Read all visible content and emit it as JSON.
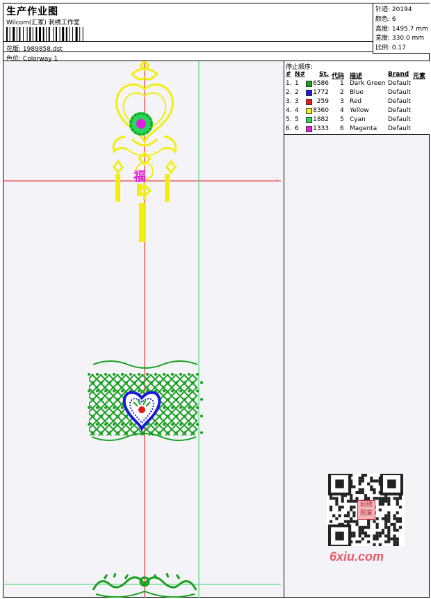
{
  "header": {
    "title": "生产作业图",
    "studio": "Wilcom(汇冢) 刺绣工作室",
    "design_label": "花版:",
    "design_file": "1989858.dst",
    "colorway_label": "色位:",
    "colorway_name": "Colorway 1"
  },
  "stats": [
    {
      "label": "针迹:",
      "value": "20194"
    },
    {
      "label": "颜色:",
      "value": "6"
    },
    {
      "label": "高度:",
      "value": "1495.7 mm"
    },
    {
      "label": "宽度:",
      "value": "330.0 mm"
    },
    {
      "label": "比例:",
      "value": "0.17"
    }
  ],
  "stop_sequence": {
    "title": "停止顺序:",
    "columns": {
      "index": "#",
      "n": "N#",
      "st": "St.",
      "code": "代码",
      "desc": "描述",
      "brand": "Brand",
      "element": "元素"
    },
    "rows": [
      {
        "index": "1.",
        "n": "1",
        "color": "#16a01e",
        "st": "6586",
        "code": "1",
        "desc": "Dark Green",
        "brand": "Default"
      },
      {
        "index": "2.",
        "n": "2",
        "color": "#1a1ad6",
        "st": "1772",
        "code": "2",
        "desc": "Blue",
        "brand": "Default"
      },
      {
        "index": "3.",
        "n": "3",
        "color": "#e41b1b",
        "st": "259",
        "code": "3",
        "desc": "Red",
        "brand": "Default"
      },
      {
        "index": "4.",
        "n": "4",
        "color": "#f2ee10",
        "st": "8360",
        "code": "4",
        "desc": "Yellow",
        "brand": "Default"
      },
      {
        "index": "5.",
        "n": "5",
        "color": "#2ad65a",
        "st": "1882",
        "code": "5",
        "desc": "Cyan",
        "brand": "Default"
      },
      {
        "index": "6.",
        "n": "6",
        "color": "#e21ee2",
        "st": "1333",
        "code": "6",
        "desc": "Magenta",
        "brand": "Default"
      }
    ]
  },
  "motif": {
    "fu_char": "福"
  },
  "watermark": {
    "site": "6xiu.com",
    "stamp": "刺绣图案"
  },
  "colors": {
    "guide_red": "#e41b1b",
    "guide_green": "#3bd66a",
    "dark_green": "#16a01e",
    "yellow": "#f2ee10",
    "blue": "#1a1ad6",
    "magenta": "#e21ee2"
  }
}
